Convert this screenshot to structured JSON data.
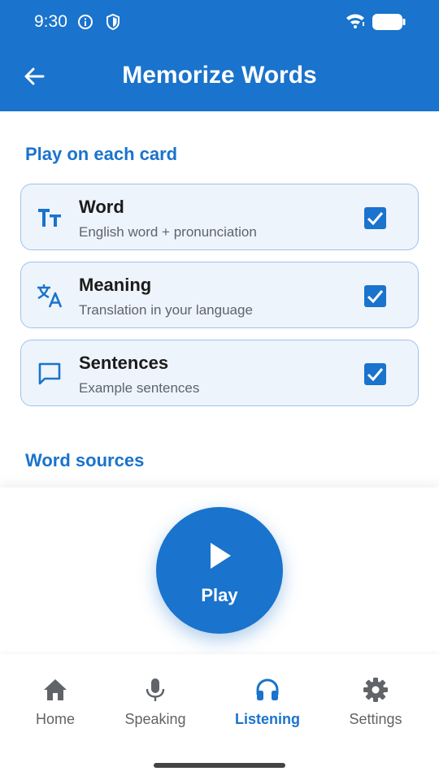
{
  "status_bar": {
    "time": "9:30",
    "icons": [
      "info-icon",
      "shield-icon",
      "wifi-icon",
      "battery-icon"
    ]
  },
  "app_bar": {
    "title": "Memorize Words",
    "back_icon": "arrow-left-icon"
  },
  "sections": {
    "play_on_each_card": "Play on each card",
    "word_sources": "Word sources"
  },
  "options": [
    {
      "title": "Word",
      "subtitle": "English word + pronunciation",
      "icon": "text-size-icon",
      "checked": true
    },
    {
      "title": "Meaning",
      "subtitle": "Translation in your language",
      "icon": "translate-icon",
      "checked": true
    },
    {
      "title": "Sentences",
      "subtitle": "Example sentences",
      "icon": "chat-bubble-icon",
      "checked": true
    }
  ],
  "player": {
    "play_label": "Play",
    "icon": "play-icon"
  },
  "bottom_nav": [
    {
      "label": "Home",
      "icon": "home-icon",
      "active": false
    },
    {
      "label": "Speaking",
      "icon": "microphone-icon",
      "active": false
    },
    {
      "label": "Listening",
      "icon": "headphones-icon",
      "active": true
    },
    {
      "label": "Settings",
      "icon": "gear-icon",
      "active": false
    }
  ],
  "colors": {
    "primary": "#1a73cc",
    "card_bg": "#eef4fc",
    "card_border": "#9ec3ea",
    "inactive": "#606468"
  }
}
